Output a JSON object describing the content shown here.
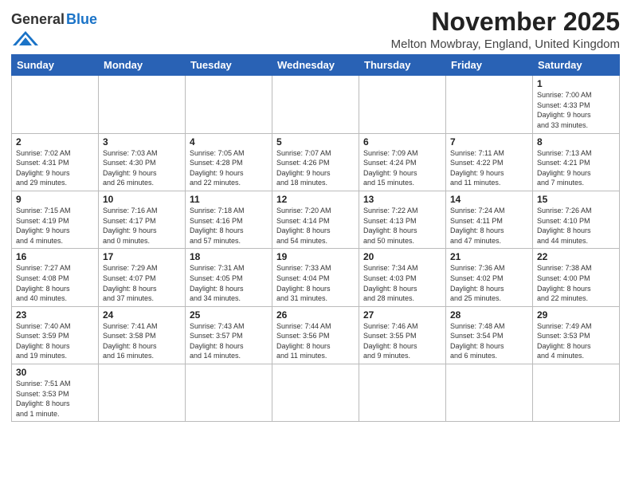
{
  "header": {
    "logo_general": "General",
    "logo_blue": "Blue",
    "month_title": "November 2025",
    "location": "Melton Mowbray, England, United Kingdom"
  },
  "days_of_week": [
    "Sunday",
    "Monday",
    "Tuesday",
    "Wednesday",
    "Thursday",
    "Friday",
    "Saturday"
  ],
  "weeks": [
    [
      {
        "day": "",
        "info": ""
      },
      {
        "day": "",
        "info": ""
      },
      {
        "day": "",
        "info": ""
      },
      {
        "day": "",
        "info": ""
      },
      {
        "day": "",
        "info": ""
      },
      {
        "day": "",
        "info": ""
      },
      {
        "day": "1",
        "info": "Sunrise: 7:00 AM\nSunset: 4:33 PM\nDaylight: 9 hours\nand 33 minutes."
      }
    ],
    [
      {
        "day": "2",
        "info": "Sunrise: 7:02 AM\nSunset: 4:31 PM\nDaylight: 9 hours\nand 29 minutes."
      },
      {
        "day": "3",
        "info": "Sunrise: 7:03 AM\nSunset: 4:30 PM\nDaylight: 9 hours\nand 26 minutes."
      },
      {
        "day": "4",
        "info": "Sunrise: 7:05 AM\nSunset: 4:28 PM\nDaylight: 9 hours\nand 22 minutes."
      },
      {
        "day": "5",
        "info": "Sunrise: 7:07 AM\nSunset: 4:26 PM\nDaylight: 9 hours\nand 18 minutes."
      },
      {
        "day": "6",
        "info": "Sunrise: 7:09 AM\nSunset: 4:24 PM\nDaylight: 9 hours\nand 15 minutes."
      },
      {
        "day": "7",
        "info": "Sunrise: 7:11 AM\nSunset: 4:22 PM\nDaylight: 9 hours\nand 11 minutes."
      },
      {
        "day": "8",
        "info": "Sunrise: 7:13 AM\nSunset: 4:21 PM\nDaylight: 9 hours\nand 7 minutes."
      }
    ],
    [
      {
        "day": "9",
        "info": "Sunrise: 7:15 AM\nSunset: 4:19 PM\nDaylight: 9 hours\nand 4 minutes."
      },
      {
        "day": "10",
        "info": "Sunrise: 7:16 AM\nSunset: 4:17 PM\nDaylight: 9 hours\nand 0 minutes."
      },
      {
        "day": "11",
        "info": "Sunrise: 7:18 AM\nSunset: 4:16 PM\nDaylight: 8 hours\nand 57 minutes."
      },
      {
        "day": "12",
        "info": "Sunrise: 7:20 AM\nSunset: 4:14 PM\nDaylight: 8 hours\nand 54 minutes."
      },
      {
        "day": "13",
        "info": "Sunrise: 7:22 AM\nSunset: 4:13 PM\nDaylight: 8 hours\nand 50 minutes."
      },
      {
        "day": "14",
        "info": "Sunrise: 7:24 AM\nSunset: 4:11 PM\nDaylight: 8 hours\nand 47 minutes."
      },
      {
        "day": "15",
        "info": "Sunrise: 7:26 AM\nSunset: 4:10 PM\nDaylight: 8 hours\nand 44 minutes."
      }
    ],
    [
      {
        "day": "16",
        "info": "Sunrise: 7:27 AM\nSunset: 4:08 PM\nDaylight: 8 hours\nand 40 minutes."
      },
      {
        "day": "17",
        "info": "Sunrise: 7:29 AM\nSunset: 4:07 PM\nDaylight: 8 hours\nand 37 minutes."
      },
      {
        "day": "18",
        "info": "Sunrise: 7:31 AM\nSunset: 4:05 PM\nDaylight: 8 hours\nand 34 minutes."
      },
      {
        "day": "19",
        "info": "Sunrise: 7:33 AM\nSunset: 4:04 PM\nDaylight: 8 hours\nand 31 minutes."
      },
      {
        "day": "20",
        "info": "Sunrise: 7:34 AM\nSunset: 4:03 PM\nDaylight: 8 hours\nand 28 minutes."
      },
      {
        "day": "21",
        "info": "Sunrise: 7:36 AM\nSunset: 4:02 PM\nDaylight: 8 hours\nand 25 minutes."
      },
      {
        "day": "22",
        "info": "Sunrise: 7:38 AM\nSunset: 4:00 PM\nDaylight: 8 hours\nand 22 minutes."
      }
    ],
    [
      {
        "day": "23",
        "info": "Sunrise: 7:40 AM\nSunset: 3:59 PM\nDaylight: 8 hours\nand 19 minutes."
      },
      {
        "day": "24",
        "info": "Sunrise: 7:41 AM\nSunset: 3:58 PM\nDaylight: 8 hours\nand 16 minutes."
      },
      {
        "day": "25",
        "info": "Sunrise: 7:43 AM\nSunset: 3:57 PM\nDaylight: 8 hours\nand 14 minutes."
      },
      {
        "day": "26",
        "info": "Sunrise: 7:44 AM\nSunset: 3:56 PM\nDaylight: 8 hours\nand 11 minutes."
      },
      {
        "day": "27",
        "info": "Sunrise: 7:46 AM\nSunset: 3:55 PM\nDaylight: 8 hours\nand 9 minutes."
      },
      {
        "day": "28",
        "info": "Sunrise: 7:48 AM\nSunset: 3:54 PM\nDaylight: 8 hours\nand 6 minutes."
      },
      {
        "day": "29",
        "info": "Sunrise: 7:49 AM\nSunset: 3:53 PM\nDaylight: 8 hours\nand 4 minutes."
      }
    ],
    [
      {
        "day": "30",
        "info": "Sunrise: 7:51 AM\nSunset: 3:53 PM\nDaylight: 8 hours\nand 1 minute."
      },
      {
        "day": "",
        "info": ""
      },
      {
        "day": "",
        "info": ""
      },
      {
        "day": "",
        "info": ""
      },
      {
        "day": "",
        "info": ""
      },
      {
        "day": "",
        "info": ""
      },
      {
        "day": "",
        "info": ""
      }
    ]
  ]
}
